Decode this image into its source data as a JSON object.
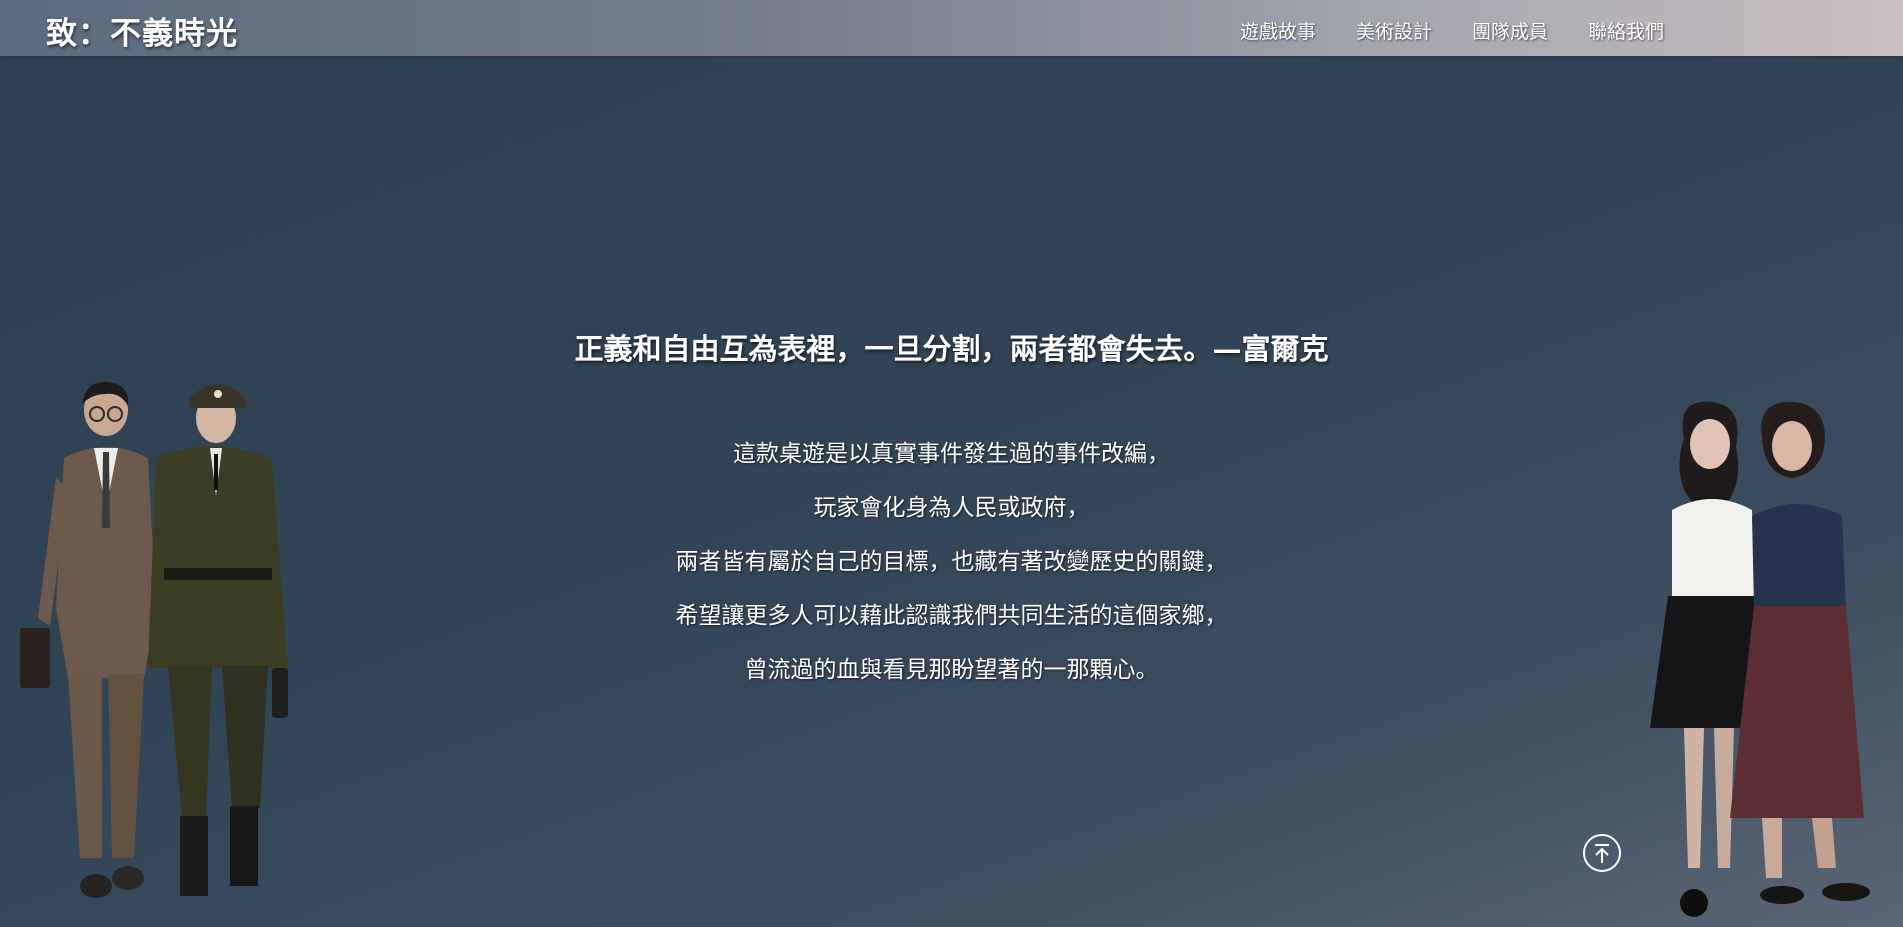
{
  "header": {
    "logo": "致：不義時光",
    "nav": [
      {
        "label": "遊戲故事"
      },
      {
        "label": "美術設計"
      },
      {
        "label": "團隊成員"
      },
      {
        "label": "聯絡我們"
      }
    ]
  },
  "hero": {
    "quote": "正義和自由互為表裡，一旦分割，兩者都會失去。—富爾克",
    "lines": [
      "這款桌遊是以真實事件發生過的事件改編，",
      "玩家會化身為人民或政府，",
      "兩者皆有屬於自己的目標，也藏有著改變歷史的關鍵，",
      "希望讓更多人可以藉此認識我們共同生活的這個家鄉，",
      "曾流過的血與看見那盼望著的一那顆心。"
    ]
  },
  "icons": {
    "scroll_top": "arrow-up-to-top-icon"
  },
  "colors": {
    "background": "#304456",
    "header_start": "#5b6b7d",
    "header_end": "#cbbfc2",
    "text": "#ffffff"
  }
}
